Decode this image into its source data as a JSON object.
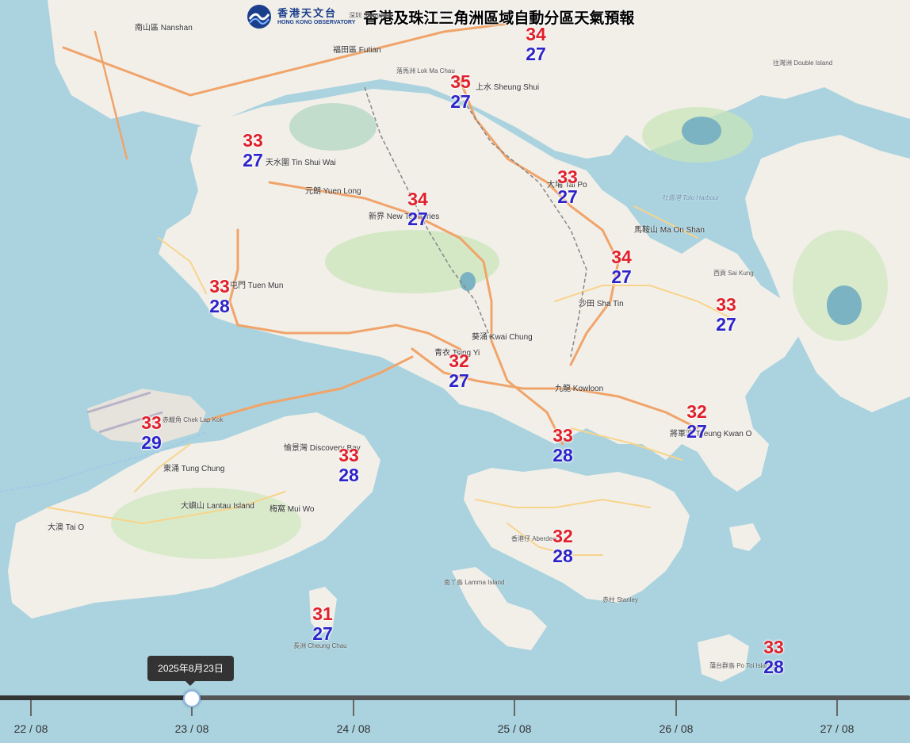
{
  "header": {
    "logo_cn": "香港天文台",
    "logo_en": "HONG KONG OBSERVATORY",
    "title": "香港及珠江三角洲區域自動分區天氣預報"
  },
  "forecast": [
    {
      "max": "34",
      "min": "27"
    },
    {
      "max": "35",
      "min": "27"
    },
    {
      "max": "33",
      "min": "27"
    },
    {
      "max": "33",
      "min": "27"
    },
    {
      "max": "34",
      "min": "27"
    },
    {
      "max": "34",
      "min": "27"
    },
    {
      "max": "33",
      "min": "28"
    },
    {
      "max": "33",
      "min": "27"
    },
    {
      "max": "32",
      "min": "27"
    },
    {
      "max": "33",
      "min": "29"
    },
    {
      "max": "32",
      "min": "27"
    },
    {
      "max": "33",
      "min": "28"
    },
    {
      "max": "33",
      "min": "28"
    },
    {
      "max": "32",
      "min": "28"
    },
    {
      "max": "31",
      "min": "27"
    },
    {
      "max": "33",
      "min": "28"
    }
  ],
  "places": {
    "nanshan": "南山區 Nanshan",
    "futian": "福田區 Futian",
    "shenzhen": "深圳 Shenzhen",
    "tin_shui_wai": "天水圍 Tin Shui Wai",
    "yuen_long": "元朗 Yuen Long",
    "new_territories": "新界 New Territories",
    "tuen_mun": "屯門 Tuen Mun",
    "sheung_shui": "上水 Sheung Shui",
    "tai_po": "大埔 Tai Po",
    "ma_on_shan": "馬鞍山 Ma On Shan",
    "sha_tin": "沙田 Sha Tin",
    "kwai_chung": "葵涌 Kwai Chung",
    "tsing_yi": "青衣 Tsing Yi",
    "kowloon": "九龍 Kowloon",
    "tseung_kwan_o": "將軍澳 Tseung Kwan O",
    "discovery_bay": "愉景灣 Discovery Bay",
    "tung_chung": "東涌 Tung Chung",
    "lantau": "大嶼山 Lantau Island",
    "mui_wo": "梅窩 Mui Wo",
    "tai_o": "大澳 Tai O",
    "cheung_chau": "長洲 Cheung Chau",
    "lamma": "南丫島 Lamma Island",
    "stanley": "赤柱 Stanley",
    "aberdeen": "香港仔 Aberdeen",
    "sai_kung": "西貢 Sai Kung",
    "po_toi": "蒲台群島 Po Toi Islands",
    "double_island": "往灣洲 Double Island",
    "tolo_harbour": "吐露港 Tolo Harbour",
    "lok_ma_chau": "落馬洲 Lok Ma Chau",
    "chek_lap_kok": "赤鱲角 Chek Lap Kok"
  },
  "timeline": {
    "tooltip": "2025年8月23日",
    "dates": [
      "22 / 08",
      "23 / 08",
      "24 / 08",
      "25 / 08",
      "26 / 08",
      "27 / 08"
    ]
  },
  "colors": {
    "sea": "#aad3df",
    "land": "#f2efe9",
    "park": "#c8e6b5",
    "reservoir": "#7bb3c2",
    "road_major": "#f0a46a",
    "road_minor": "#f8d48a",
    "temp_max": "#e0202a",
    "temp_min": "#2d23c8"
  }
}
